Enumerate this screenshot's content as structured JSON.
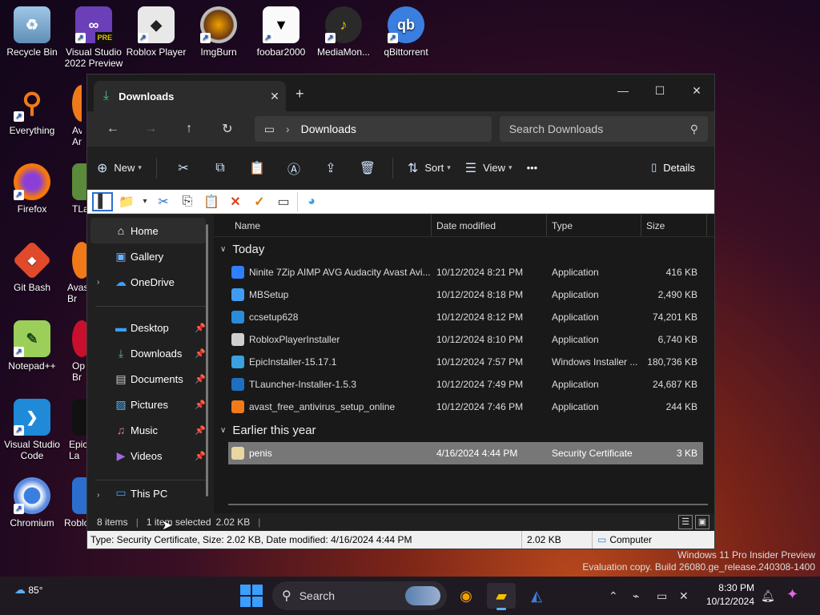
{
  "desktop": {
    "icons": [
      {
        "label": "Recycle Bin"
      },
      {
        "label": "Visual Studio 2022 Preview",
        "badge": "PRE"
      },
      {
        "label": "Roblox Player"
      },
      {
        "label": "ImgBurn"
      },
      {
        "label": "foobar2000"
      },
      {
        "label": "MediaMon..."
      },
      {
        "label": "qBittorrent",
        "glyph": "qb"
      },
      {
        "label": "Everything"
      },
      {
        "label": "Ava An"
      },
      {
        "label": "Firefox"
      },
      {
        "label": "TLa"
      },
      {
        "label": "Git Bash"
      },
      {
        "label": "Avas Br"
      },
      {
        "label": "Notepad++"
      },
      {
        "label": "Op Br"
      },
      {
        "label": "Visual Studio Code"
      },
      {
        "label": "Epic La"
      },
      {
        "label": "Chromium"
      },
      {
        "label": "Roblo"
      }
    ]
  },
  "window": {
    "tab_title": "Downloads",
    "address_location": "Downloads",
    "search_placeholder": "Search Downloads",
    "toolbar": {
      "new_label": "New",
      "sort_label": "Sort",
      "view_label": "View",
      "more_label": "•••",
      "details_label": "Details"
    },
    "nav": {
      "home": "Home",
      "gallery": "Gallery",
      "onedrive": "OneDrive",
      "desktop": "Desktop",
      "downloads": "Downloads",
      "documents": "Documents",
      "pictures": "Pictures",
      "music": "Music",
      "videos": "Videos",
      "thispc": "This PC"
    },
    "columns": {
      "name": "Name",
      "date": "Date modified",
      "type": "Type",
      "size": "Size"
    },
    "groups": {
      "today": "Today",
      "earlier": "Earlier this year"
    },
    "files_today": [
      {
        "name": "Ninite 7Zip AIMP AVG Audacity Avast Avi...",
        "date": "10/12/2024 8:21 PM",
        "type": "Application",
        "size": "416 KB",
        "color": "#2f7fff"
      },
      {
        "name": "MBSetup",
        "date": "10/12/2024 8:18 PM",
        "type": "Application",
        "size": "2,490 KB",
        "color": "#3f9cf0"
      },
      {
        "name": "ccsetup628",
        "date": "10/12/2024 8:12 PM",
        "type": "Application",
        "size": "74,201 KB",
        "color": "#2a8bd8"
      },
      {
        "name": "RobloxPlayerInstaller",
        "date": "10/12/2024 8:10 PM",
        "type": "Application",
        "size": "6,740 KB",
        "color": "#cfcfcf"
      },
      {
        "name": "EpicInstaller-15.17.1",
        "date": "10/12/2024 7:57 PM",
        "type": "Windows Installer ...",
        "size": "180,736 KB",
        "color": "#3aa0e0"
      },
      {
        "name": "TLauncher-Installer-1.5.3",
        "date": "10/12/2024 7:49 PM",
        "type": "Application",
        "size": "24,687 KB",
        "color": "#1f6fc0"
      },
      {
        "name": "avast_free_antivirus_setup_online",
        "date": "10/12/2024 7:46 PM",
        "type": "Application",
        "size": "244 KB",
        "color": "#f07a1a"
      }
    ],
    "files_earlier": [
      {
        "name": "penis",
        "date": "4/16/2024 4:44 PM",
        "type": "Security Certificate",
        "size": "3 KB",
        "color": "#e8d8a0"
      }
    ],
    "status": {
      "items": "8 items",
      "selected": "1 item selected",
      "selected_size": "2.02 KB"
    },
    "classic_status": {
      "info": "Type: Security Certificate, Size: 2.02 KB, Date modified: 4/16/2024 4:44 PM",
      "size": "2.02 KB",
      "zone": "Computer"
    }
  },
  "watermark": {
    "line1": "Windows 11 Pro Insider Preview",
    "line2": "Evaluation copy. Build 26080.ge_release.240308-1400"
  },
  "taskbar": {
    "temperature": "85°",
    "search_label": "Search",
    "time": "8:30 PM",
    "date": "10/12/2024"
  }
}
